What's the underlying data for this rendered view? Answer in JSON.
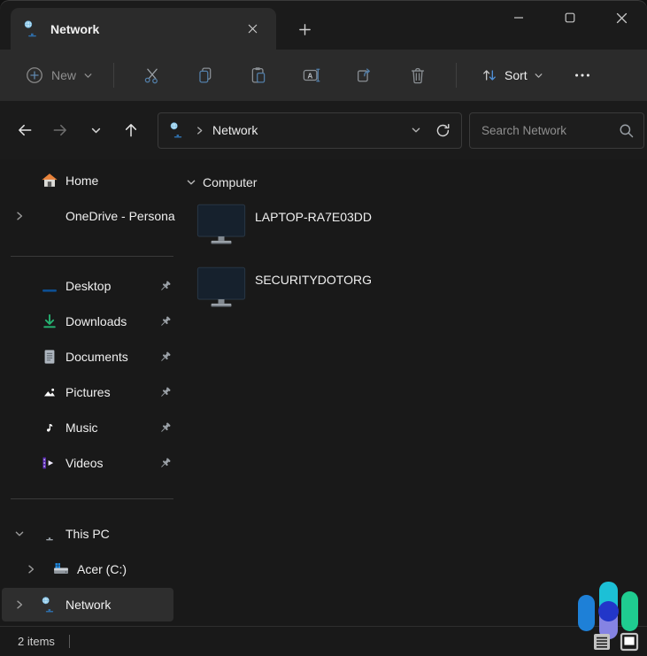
{
  "window": {
    "title": "Network"
  },
  "titlebar": {
    "tab_label": "Network",
    "controls": [
      "minimize",
      "maximize",
      "close"
    ]
  },
  "toolbar": {
    "new_label": "New",
    "sort_label": "Sort",
    "disabled_icons": [
      "cut",
      "copy",
      "paste",
      "rename",
      "share",
      "delete"
    ],
    "more_icon": "see-more"
  },
  "addressbar": {
    "location": "Network",
    "search_placeholder": "Search Network"
  },
  "sidebar": {
    "items": [
      {
        "label": "Home"
      },
      {
        "label": "OneDrive - Persona"
      },
      {
        "label": "Desktop"
      },
      {
        "label": "Downloads"
      },
      {
        "label": "Documents"
      },
      {
        "label": "Pictures"
      },
      {
        "label": "Music"
      },
      {
        "label": "Videos"
      },
      {
        "label": "This PC"
      },
      {
        "label": "Acer (C:)"
      },
      {
        "label": "Network"
      }
    ]
  },
  "content": {
    "group_label": "Computer",
    "items": [
      {
        "name": "LAPTOP-RA7E03DD"
      },
      {
        "name": "SECURITYDOTORG"
      }
    ]
  },
  "statusbar": {
    "item_count": "2 items"
  },
  "brand": {
    "logo_colors": {
      "blue": "#1e80d7",
      "cyan": "#1cc0d6",
      "purple": "#8583e3",
      "green": "#1fcc90",
      "circle": "#2236c9"
    }
  }
}
